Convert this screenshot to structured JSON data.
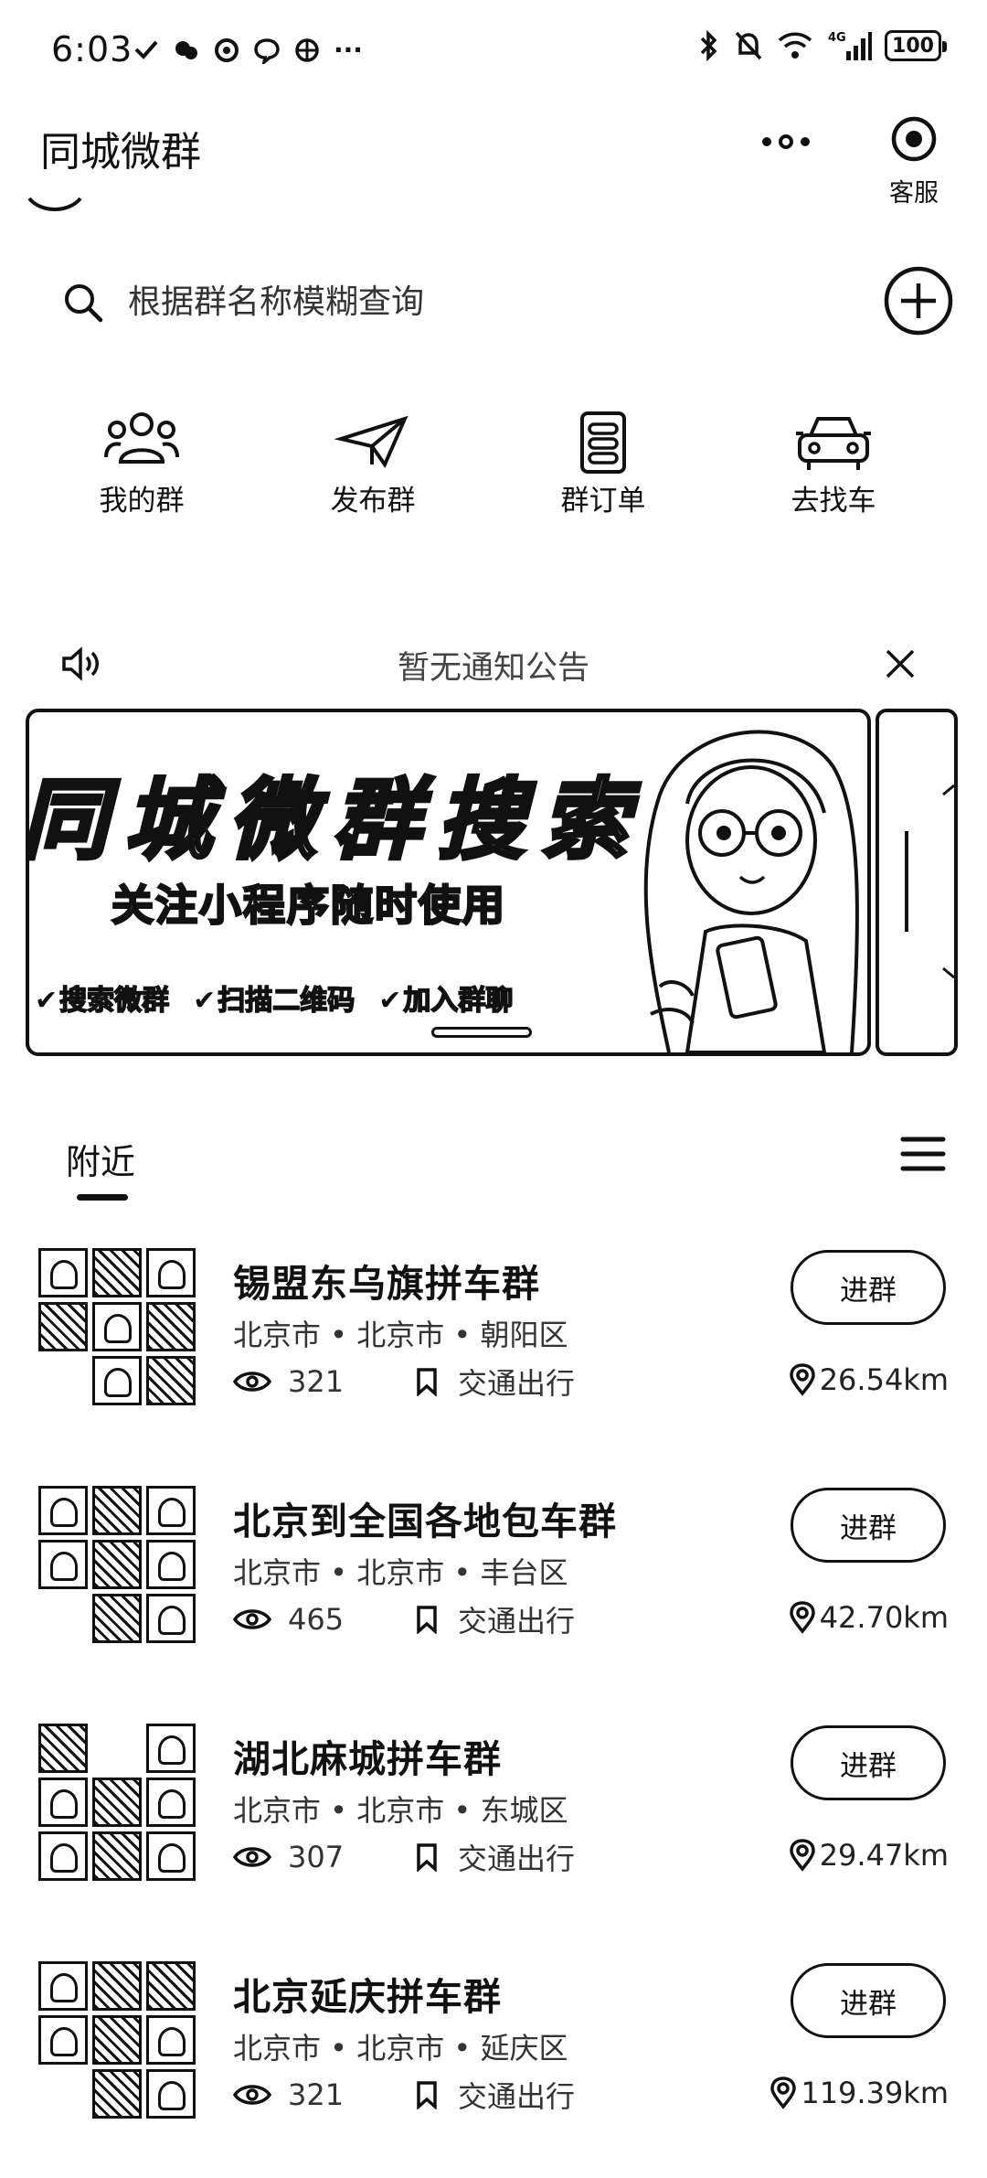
{
  "status": {
    "time": "6:03",
    "battery": "100",
    "network": "4G"
  },
  "header": {
    "title": "同城微群",
    "service_label": "客服"
  },
  "search": {
    "placeholder": "根据群名称模糊查询"
  },
  "quick_menu": [
    {
      "label": "我的群",
      "icon": "people-icon"
    },
    {
      "label": "发布群",
      "icon": "paper-plane-icon"
    },
    {
      "label": "群订单",
      "icon": "order-list-icon"
    },
    {
      "label": "去找车",
      "icon": "car-icon"
    }
  ],
  "notice": {
    "text": "暂无通知公告"
  },
  "banner": {
    "title": "同城微群搜索",
    "subtitle": "关注小程序随时使用",
    "tags": [
      "搜索微群",
      "扫描二维码",
      "加入群聊"
    ]
  },
  "tabs": {
    "nearby": "附近"
  },
  "groups": [
    {
      "name": "锡盟东乌旗拼车群",
      "location": "北京市 • 北京市 • 朝阳区",
      "views": "321",
      "category": "交通出行",
      "distance": "26.54km",
      "join_label": "进群"
    },
    {
      "name": "北京到全国各地包车群",
      "location": "北京市 • 北京市 • 丰台区",
      "views": "465",
      "category": "交通出行",
      "distance": "42.70km",
      "join_label": "进群"
    },
    {
      "name": "湖北麻城拼车群",
      "location": "北京市 • 北京市 • 东城区",
      "views": "307",
      "category": "交通出行",
      "distance": "29.47km",
      "join_label": "进群"
    },
    {
      "name": "北京延庆拼车群",
      "location": "北京市 • 北京市 • 延庆区",
      "views": "321",
      "category": "交通出行",
      "distance": "119.39km",
      "join_label": "进群"
    }
  ]
}
